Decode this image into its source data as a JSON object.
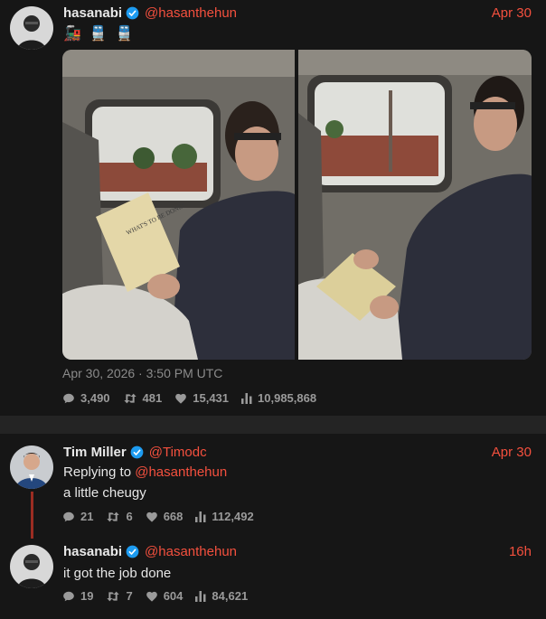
{
  "main_tweet": {
    "author": "hasanabi",
    "handle": "@hasanthehun",
    "time": "Apr 30",
    "emojis": [
      "🚂",
      "🚆",
      "🚆"
    ],
    "photos": [
      {
        "description": "man reading book on train"
      },
      {
        "description": "man looking out train window holding book"
      }
    ],
    "book_title": "WHAT'S TO BE DONE?",
    "timestamp": "Apr 30, 2026 · 3:50 PM UTC",
    "stats": {
      "replies": "3,490",
      "retweets": "481",
      "likes": "15,431",
      "views": "10,985,868"
    }
  },
  "replies": [
    {
      "author": "Tim Miller",
      "handle": "@Timodc",
      "time": "Apr 30",
      "replying_prefix": "Replying to ",
      "replying_to": "@hasanthehun",
      "text": "a little cheugy",
      "stats": {
        "replies": "21",
        "retweets": "6",
        "likes": "668",
        "views": "112,492"
      }
    },
    {
      "author": "hasanabi",
      "handle": "@hasanthehun",
      "time": "16h",
      "text": "it got the job done",
      "stats": {
        "replies": "19",
        "retweets": "7",
        "likes": "604",
        "views": "84,621"
      }
    }
  ],
  "colors": {
    "accent": "#f4503e",
    "background": "#161616",
    "verified": "#1d9bf0",
    "thread_line": "#9b2d22"
  },
  "icons": [
    "reply-icon",
    "retweet-icon",
    "like-icon",
    "views-icon",
    "verified-icon"
  ]
}
